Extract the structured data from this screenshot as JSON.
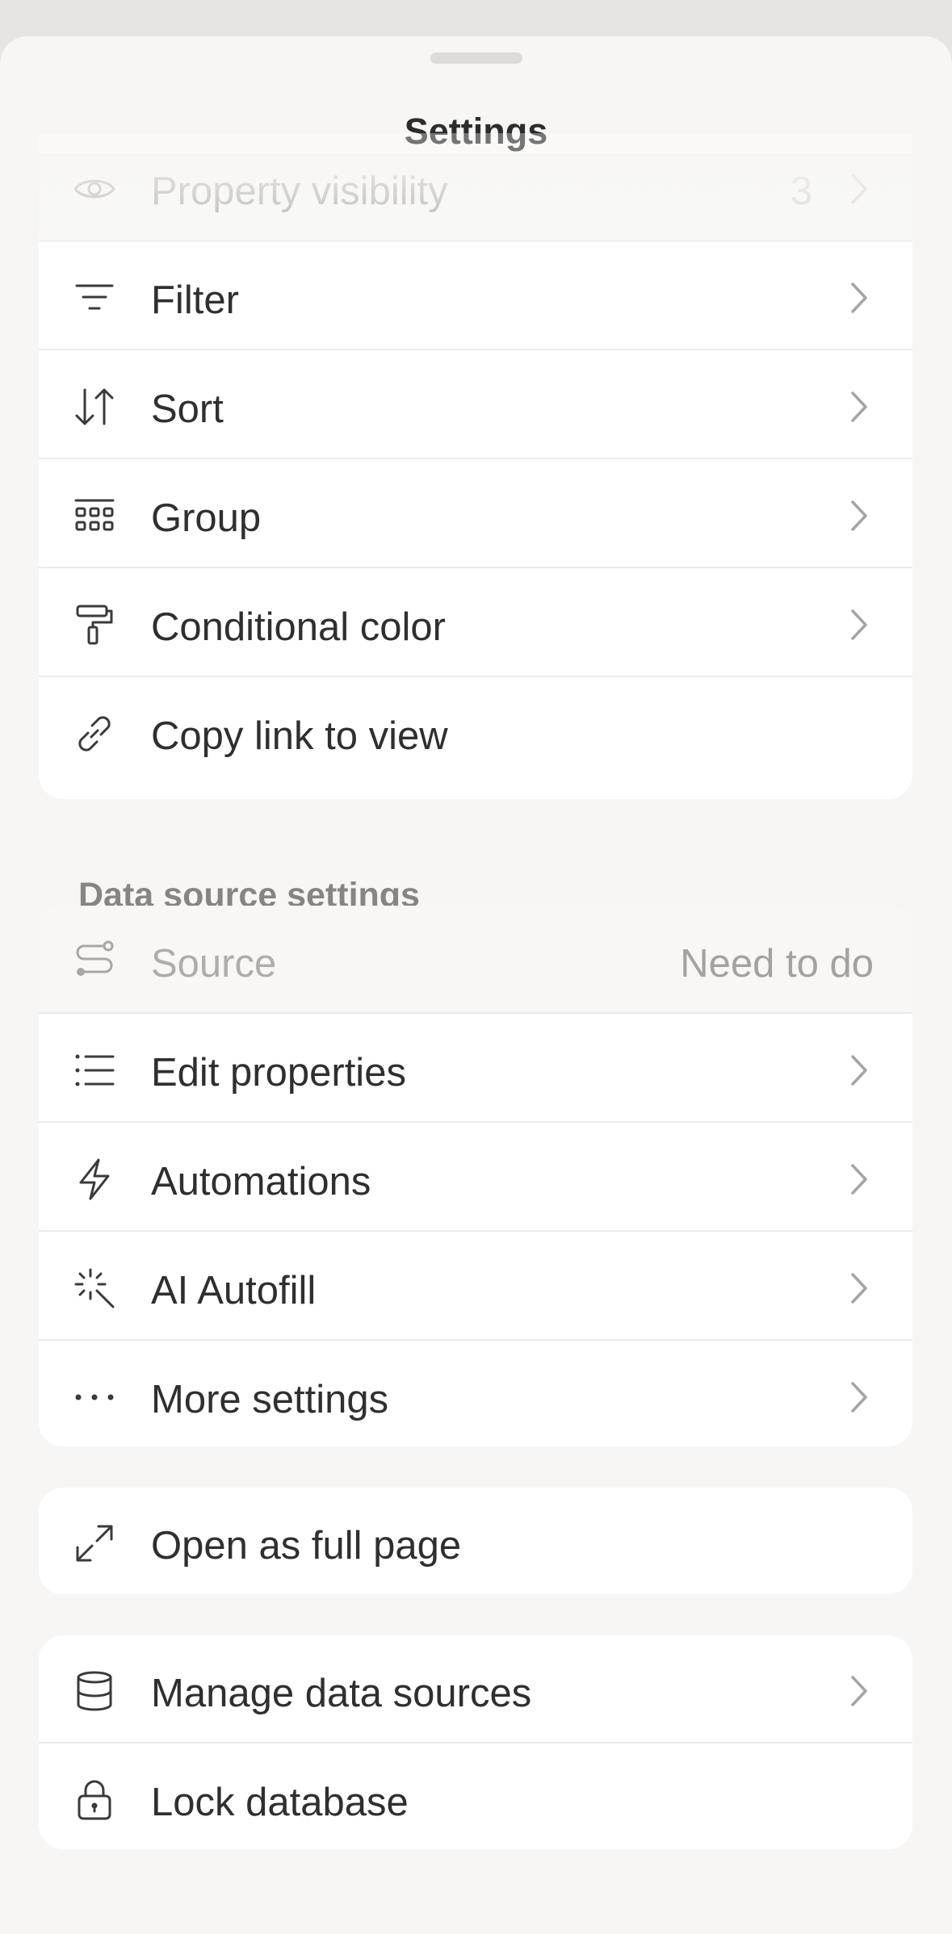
{
  "sheet": {
    "title": "Settings"
  },
  "view_settings": {
    "property_visibility": {
      "label": "Property visibility",
      "count": "3"
    },
    "items": [
      {
        "label": "Filter",
        "icon": "filter-icon"
      },
      {
        "label": "Sort",
        "icon": "sort-icon"
      },
      {
        "label": "Group",
        "icon": "group-icon"
      },
      {
        "label": "Conditional color",
        "icon": "paint-roller-icon"
      },
      {
        "label": "Copy link to view",
        "icon": "link-icon"
      }
    ]
  },
  "data_source": {
    "section_label": "Data source settings",
    "source": {
      "label": "Source",
      "value": "Need to do"
    },
    "items": [
      {
        "label": "Edit properties",
        "icon": "list-icon"
      },
      {
        "label": "Automations",
        "icon": "lightning-icon"
      },
      {
        "label": "AI Autofill",
        "icon": "sparkle-icon"
      },
      {
        "label": "More settings",
        "icon": "more-icon"
      }
    ]
  },
  "page": {
    "open_full_page": "Open as full page"
  },
  "database": {
    "manage_sources": "Manage data sources",
    "lock": "Lock database"
  }
}
